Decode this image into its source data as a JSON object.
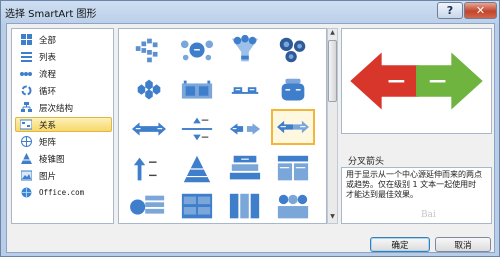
{
  "window": {
    "title": "选择 SmartArt 图形",
    "help_glyph": "?",
    "close_glyph": "✕"
  },
  "categories": [
    {
      "label": "全部",
      "icon": "grid-icon"
    },
    {
      "label": "列表",
      "icon": "list-icon"
    },
    {
      "label": "流程",
      "icon": "process-icon"
    },
    {
      "label": "循环",
      "icon": "cycle-icon"
    },
    {
      "label": "层次结构",
      "icon": "hierarchy-icon"
    },
    {
      "label": "关系",
      "icon": "relationship-icon",
      "selected": true
    },
    {
      "label": "矩阵",
      "icon": "matrix-icon"
    },
    {
      "label": "棱锥图",
      "icon": "pyramid-icon"
    },
    {
      "label": "图片",
      "icon": "picture-icon"
    },
    {
      "label": "Office.com",
      "icon": "office-icon"
    }
  ],
  "preview": {
    "title": "分叉箭头"
  },
  "description": {
    "lines": [
      "用于显示从一个中心源延伸而来的两点",
      "或趋势。仅在级别 1 文本一起使用时",
      "才能达到最佳效果。"
    ]
  },
  "buttons": {
    "ok": "确定",
    "cancel": "取消"
  },
  "watermark": "Bai",
  "colors": {
    "accent": "#3f7ecb",
    "selected_bg": "#fbe39a",
    "arrow_red": "#d9362b",
    "arrow_green": "#6eb43f"
  }
}
